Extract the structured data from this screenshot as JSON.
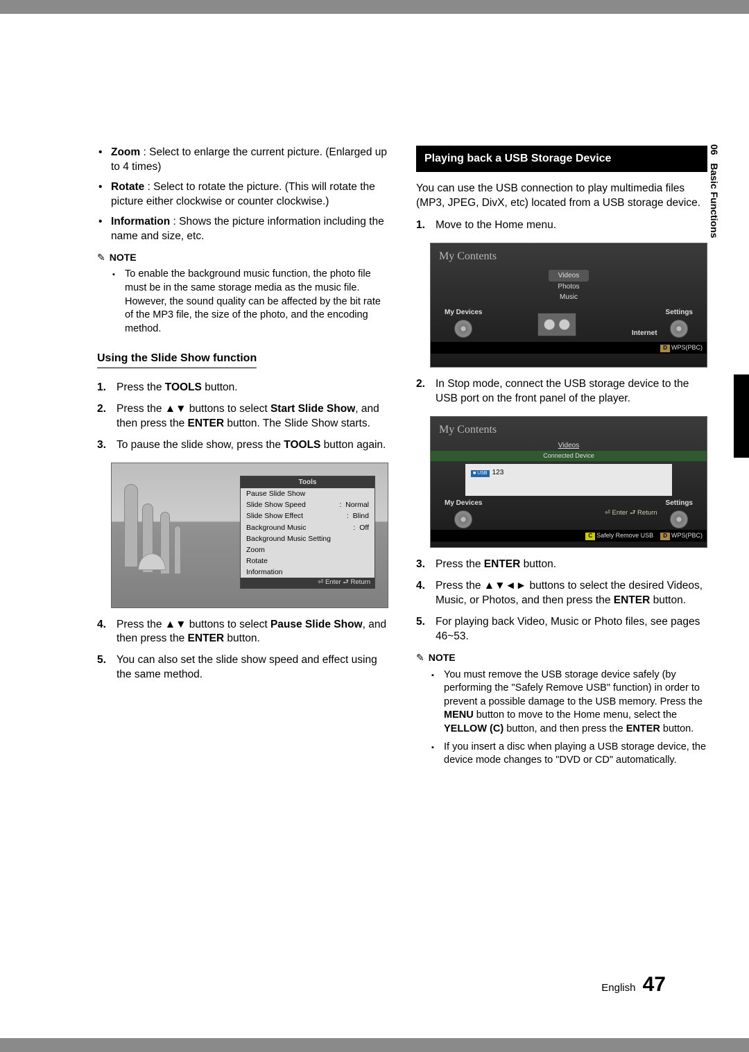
{
  "sidebar": {
    "chapter": "06",
    "title": "Basic Functions"
  },
  "footer": {
    "lang": "English",
    "page": "47"
  },
  "left": {
    "bullets": [
      {
        "term": "Zoom",
        "desc": " : Select to enlarge the current picture. (Enlarged up to 4 times)"
      },
      {
        "term": "Rotate",
        "desc": " : Select to rotate the picture. (This will rotate the picture either clockwise or counter clockwise.)"
      },
      {
        "term": "Information",
        "desc": " : Shows the picture information including the name and size, etc."
      }
    ],
    "note_label": "NOTE",
    "note1": "To enable the background music function, the photo file must be in the same storage media as the music file. However, the sound quality can be affected by the bit rate of the MP3 file, the size of the photo, and the encoding method.",
    "subhead": "Using the Slide Show function",
    "steps1": {
      "s1a": "Press the ",
      "s1b": "TOOLS",
      "s1c": " button.",
      "s2a": "Press the ▲▼ buttons to select ",
      "s2b": "Start Slide Show",
      "s2c": ", and then press the ",
      "s2d": "ENTER",
      "s2e": " button. The Slide Show starts.",
      "s3a": "To pause the slide show, press the ",
      "s3b": "TOOLS",
      "s3c": " button again."
    },
    "steps2": {
      "s4a": "Press the ▲▼ buttons to select ",
      "s4b": "Pause Slide Show",
      "s4c": ", and then press the ",
      "s4d": "ENTER",
      "s4e": " button.",
      "s5": "You can also set the slide show speed and effect using the same method."
    },
    "tools": {
      "header": "Tools",
      "pause": "Pause Slide Show",
      "speed_k": "Slide Show Speed",
      "speed_v": "Normal",
      "effect_k": "Slide Show Effect",
      "effect_v": "Blind",
      "bgm_k": "Background Music",
      "bgm_v": "Off",
      "bgms": "Background Music Setting",
      "zoom": "Zoom",
      "rotate": "Rotate",
      "info": "Information",
      "footer": "⏎ Enter   ⮐ Return"
    }
  },
  "right": {
    "section": "Playing back a USB Storage Device",
    "intro": "You can use the USB connection to play multimedia files (MP3, JPEG, DivX, etc) located from a USB storage device.",
    "step1": "Move to the Home menu.",
    "panel1": {
      "title": "My Contents",
      "videos": "Videos",
      "photos": "Photos",
      "music": "Music",
      "mydev": "My Devices",
      "internet": "Internet",
      "settings": "Settings",
      "wps": "WPS(PBC)",
      "wps_chip": "D"
    },
    "step2": "In Stop mode, connect the USB storage device to the USB port on the front panel of the player.",
    "panel2": {
      "title": "My Contents",
      "videos": "Videos",
      "connected": "Connected Device",
      "dev_badge": "■ USB",
      "dev": "123",
      "mydev": "My Devices",
      "settings": "Settings",
      "enter_return": "⏎ Enter   ⮐ Return",
      "safely_chip": "C",
      "safely": "Safely Remove USB",
      "wps_chip": "D",
      "wps": "WPS(PBC)"
    },
    "step3a": "Press the ",
    "step3b": "ENTER",
    "step3c": " button.",
    "step4a": "Press the ▲▼◄► buttons to select the desired Videos, Music, or Photos, and then press the ",
    "step4b": "ENTER",
    "step4c": " button.",
    "step5": "For playing back Video, Music or Photo files, see pages 46~53.",
    "note_label": "NOTE",
    "note_items": {
      "n1a": "You must remove the USB storage device safely (by performing the \"Safely Remove USB\" function) in order to prevent a possible damage to the USB memory. Press the ",
      "n1b": "MENU",
      "n1c": " button to move to the Home menu, select the ",
      "n1d": "YELLOW (C)",
      "n1e": " button, and then press the ",
      "n1f": "ENTER",
      "n1g": " button.",
      "n2": "If you insert a disc when playing a USB storage device, the device mode changes to \"DVD or CD\" automatically."
    }
  }
}
